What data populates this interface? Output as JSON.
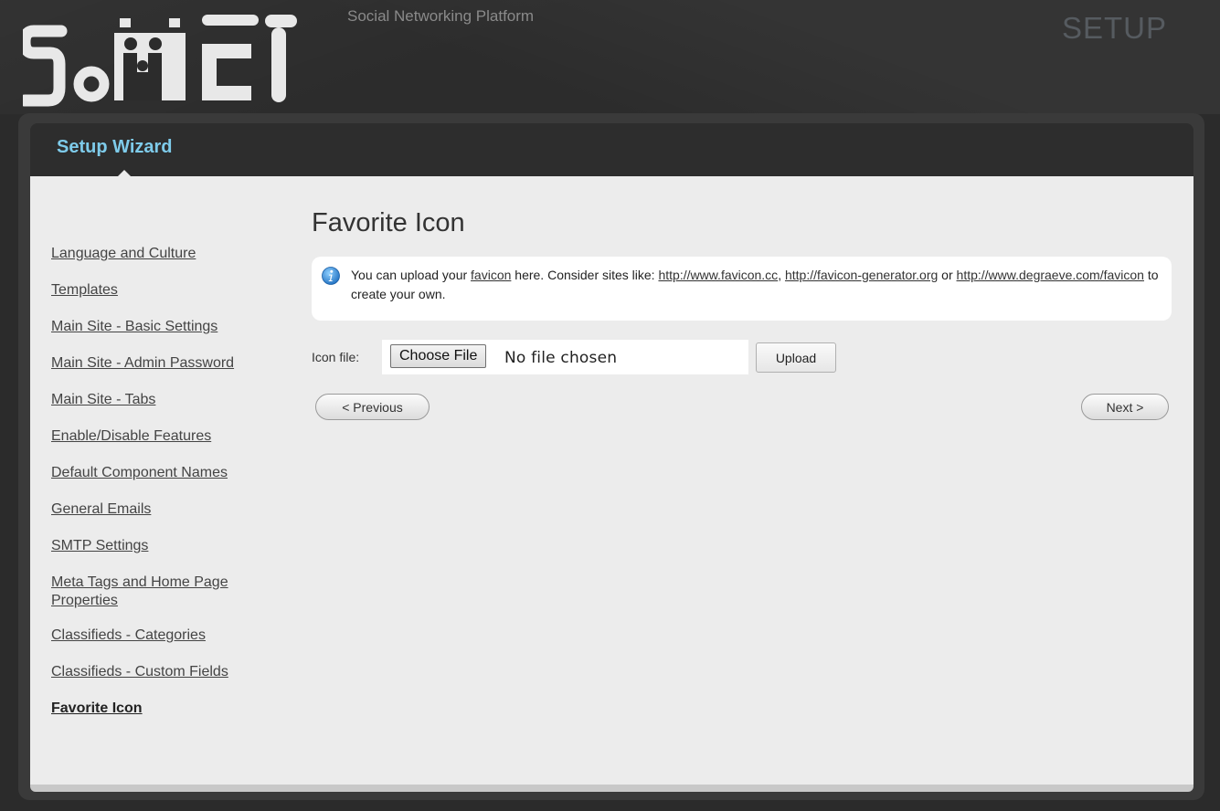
{
  "header": {
    "logo_text": "SocIET",
    "tagline": "Social Networking Platform",
    "setup_label": "SETUP"
  },
  "wizard": {
    "title": "Setup Wizard"
  },
  "sidebar": {
    "items": [
      {
        "label": "Language and Culture"
      },
      {
        "label": "Templates"
      },
      {
        "label": "Main Site - Basic Settings"
      },
      {
        "label": "Main Site - Admin Password"
      },
      {
        "label": "Main Site - Tabs"
      },
      {
        "label": "Enable/Disable Features"
      },
      {
        "label": "Default Component Names"
      },
      {
        "label": "General Emails"
      },
      {
        "label": "SMTP Settings"
      },
      {
        "label": "Meta Tags and Home Page Properties"
      },
      {
        "label": "Classifieds - Categories"
      },
      {
        "label": "Classifieds - Custom Fields"
      },
      {
        "label": "Favorite Icon"
      }
    ],
    "active": "Favorite Icon"
  },
  "main": {
    "title": "Favorite Icon",
    "info": {
      "t1": "You can upload your ",
      "link_favicon": "favicon",
      "t2": " here. Consider sites like: ",
      "link1": "http://www.favicon.cc",
      "sep": ", ",
      "link2": "http://favicon-generator.org",
      "t3": " or ",
      "link3": "http://www.degraeve.com/favicon",
      "t4": " to create your own."
    },
    "icon_file_label": "Icon file:",
    "choose_file_label": "Choose File",
    "no_file_text": "No file chosen",
    "upload_label": "Upload",
    "previous_label": "< Previous",
    "next_label": "Next >"
  },
  "colors": {
    "accent": "#7ecbea",
    "info_icon": "#3a8fd6"
  }
}
